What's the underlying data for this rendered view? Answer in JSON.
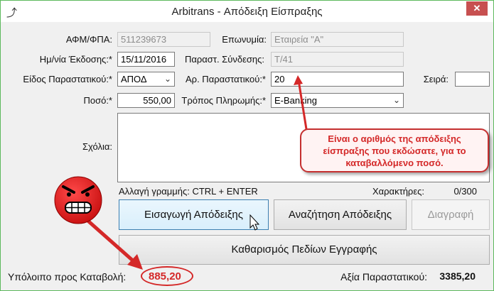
{
  "window": {
    "title": "Arbitrans - Απόδειξη Είσπραξης",
    "close": "✕",
    "icon": "arbitrans-logo-icon"
  },
  "labels": {
    "afm": "ΑΦΜ/ΦΠΑ:",
    "eponymia": "Επωνυμία:",
    "date": "Ημ/νία Έκδοσης:*",
    "link": "Παραστ. Σύνδεσης:",
    "type": "Είδος Παραστατικού:*",
    "docnum": "Αρ. Παραστατικού:*",
    "series": "Σειρά:",
    "amount": "Ποσό:*",
    "payment": "Τρόπος Πληρωμής:*",
    "comments": "Σχόλια:"
  },
  "fields": {
    "afm": "511239673",
    "eponymia": "Εταιρεία \"Α\"",
    "date": "15/11/2016",
    "link": "Τ/41",
    "type": "ΑΠΟΔ",
    "docnum": "20",
    "series": "",
    "amount": "550,00",
    "payment": "E-Banking",
    "comments": ""
  },
  "hint": "Αλλαγή γραμμής: CTRL + ENTER",
  "chars": {
    "label": "Χαρακτήρες:",
    "value": "0/300"
  },
  "buttons": {
    "insert": "Εισαγωγή Απόδειξης",
    "search": "Αναζήτηση Απόδειξης",
    "delete": "Διαγραφή",
    "clear": "Καθαρισμός Πεδίων Εγγραφής"
  },
  "footer": {
    "balance_label": "Υπόλοιπο προς Καταβολή:",
    "balance_value": "885,20",
    "doc_value_label": "Αξία Παραστατικού:",
    "doc_value": "3385,20"
  },
  "callout": {
    "text": "Είναι ο αριθμός  της απόδειξης είσπραξης που εκδώσατε, για το καταβαλλόμενο ποσό."
  },
  "colors": {
    "accent_red": "#d42828",
    "window_border": "#5db95d",
    "close_button": "#c75050"
  }
}
